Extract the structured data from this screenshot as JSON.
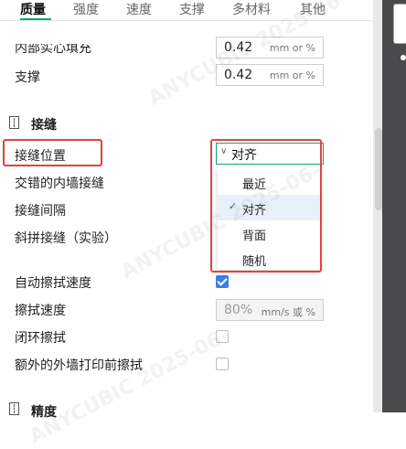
{
  "tabs": [
    "质量",
    "强度",
    "速度",
    "支撑",
    "多材料",
    "其他"
  ],
  "active_tab": "质量",
  "rows_top": [
    {
      "label": "内部实心填充",
      "value": "0.42",
      "unit": "mm or %"
    },
    {
      "label": "支撑",
      "value": "0.42",
      "unit": "mm or %"
    }
  ],
  "seam_section": {
    "title": "接缝",
    "seam_position": {
      "label": "接缝位置",
      "value": "对齐"
    },
    "staggered_label": "交错的内墙接缝",
    "seam_gap_label": "接缝间隔",
    "scarf_label": "斜拼接缝（实验）",
    "dropdown_options": [
      "最近",
      "对齐",
      "背面",
      "随机"
    ],
    "dropdown_selected": "对齐",
    "auto_wipe_label": "自动擦拭速度",
    "auto_wipe_checked": true,
    "wipe_speed": {
      "label": "擦拭速度",
      "value": "80%",
      "unit": "mm/s 或 %"
    },
    "loop_wipe_label": "闭环擦拭",
    "loop_wipe_checked": false,
    "extra_wipe_label": "额外的外墙打印前擦拭",
    "extra_wipe_checked": false
  },
  "next_section_title": "精度",
  "watermark_text": "ANYCUBIC 2025-06-"
}
